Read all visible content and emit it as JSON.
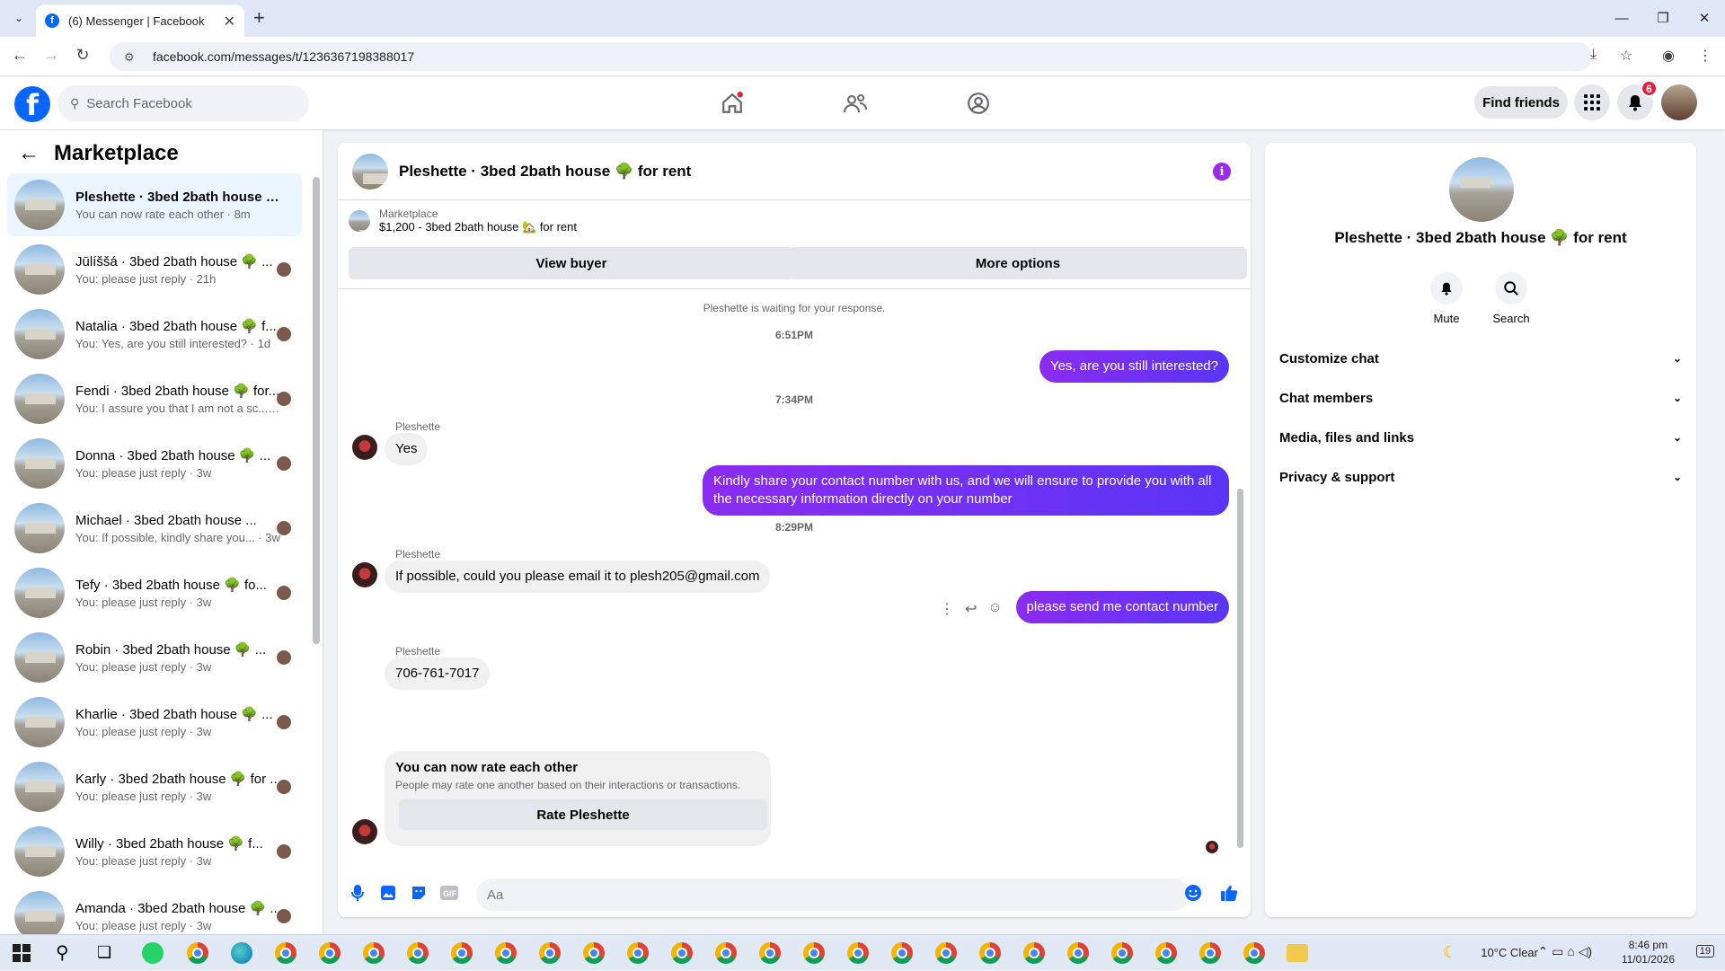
{
  "browser": {
    "tab_title": "(6) Messenger | Facebook",
    "url": "facebook.com/messages/t/1236367198388017"
  },
  "header": {
    "search_placeholder": "Search Facebook",
    "find_friends": "Find friends",
    "notif_count": "6"
  },
  "sidebar": {
    "title": "Marketplace",
    "conversations": [
      {
        "title": "Pleshette · 3bed 2bath house 🌳 ...",
        "sub": "You can now rate each other · 8m",
        "active": true
      },
      {
        "title": "Jūlíššá · 3bed 2bath house 🌳 ...",
        "sub": "You: please just reply · 21h"
      },
      {
        "title": "Natalia · 3bed 2bath house 🌳 f...",
        "sub": "You: Yes, are you still interested? · 1d"
      },
      {
        "title": "Fendi · 3bed 2bath house 🌳 for...",
        "sub": "You: I assure you that I am not a sc... · 1w"
      },
      {
        "title": "Donna · 3bed 2bath house 🌳 ...",
        "sub": "You: please just reply · 3w"
      },
      {
        "title": "Michael · 3bed 2bath house ...",
        "sub": "You: If possible, kindly share you... · 3w"
      },
      {
        "title": "Tefy · 3bed 2bath house 🌳 fo...",
        "sub": "You: please just reply · 3w"
      },
      {
        "title": "Robin · 3bed 2bath house 🌳 ...",
        "sub": "You: please just reply · 3w"
      },
      {
        "title": "Kharlie · 3bed 2bath house 🌳 ...",
        "sub": "You: please just reply · 3w"
      },
      {
        "title": "Karly · 3bed 2bath house 🌳 for ...",
        "sub": "You: please just reply · 3w"
      },
      {
        "title": "Willy · 3bed 2bath house 🌳 f...",
        "sub": "You: please just reply · 3w"
      },
      {
        "title": "Amanda · 3bed 2bath house 🌳 ...",
        "sub": "You: please just reply · 3w"
      }
    ]
  },
  "chat": {
    "title": "Pleshette · 3bed 2bath house 🌳 for rent",
    "listing_source": "Marketplace",
    "listing_line": "$1,200 - 3bed 2bath house 🏡 for rent",
    "view_buyer": "View buyer",
    "more_options": "More options",
    "waiting": "Pleshette is waiting for your response.",
    "time1": "6:51PM",
    "out1": "Yes, are you still interested?",
    "time2": "7:34PM",
    "sender": "Pleshette",
    "in1": "Yes",
    "out2": "Kindly share your contact number with us, and we will ensure to provide you with all the necessary information directly on your number",
    "time3": "8:29PM",
    "in2": "If possible, could you please email it to plesh205@gmail.com",
    "out3": "please send me contact number",
    "in3": "706-761-7017",
    "rate_title": "You can now rate each other",
    "rate_sub": "People may rate one another based on their interactions or transactions.",
    "rate_button": "Rate Pleshette",
    "input_placeholder": "Aa"
  },
  "rpanel": {
    "title": "Pleshette · 3bed 2bath house 🌳 for rent",
    "mute": "Mute",
    "search": "Search",
    "rows": [
      "Customize chat",
      "Chat members",
      "Media, files and links",
      "Privacy & support"
    ]
  },
  "taskbar": {
    "weather": "10°C  Clear",
    "time": "8:46 pm",
    "date": "11/01/2026",
    "notif": "19"
  },
  "colors": {
    "fb_blue": "#0866ff",
    "outgoing_bubble": "#7a1cf3",
    "info_icon": "#9d28f0"
  }
}
